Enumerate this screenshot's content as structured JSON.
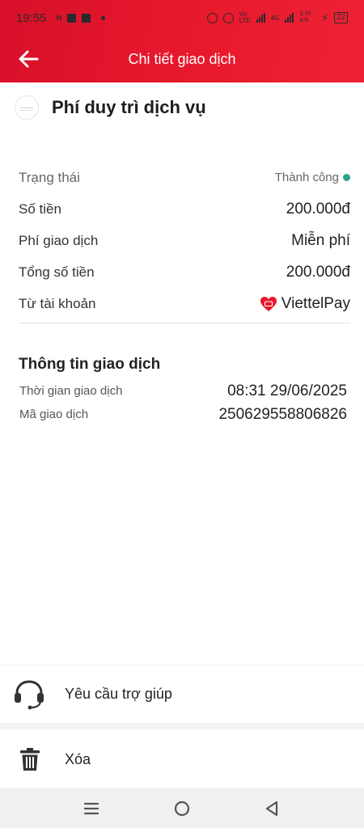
{
  "status_bar": {
    "time": "19:55",
    "left_small": "H",
    "volte": "Vo LTE",
    "network": "4G",
    "speed": "3.70 K/S",
    "battery": "22"
  },
  "header": {
    "title": "Chi tiết giao dịch"
  },
  "service": {
    "name": "Phí duy trì dịch vụ"
  },
  "details": [
    {
      "label": "Trạng thái",
      "value": "Thành công"
    },
    {
      "label": "Số tiền",
      "value": "200.000đ"
    },
    {
      "label": "Phí giao dịch",
      "value": "Miễn phí"
    },
    {
      "label": "Tổng số tiền",
      "value": "200.000đ"
    },
    {
      "label": "Từ tài khoản",
      "value": "ViettelPay"
    }
  ],
  "info": {
    "title": "Thông tin giao dịch",
    "rows": [
      {
        "label": "Thời gian giao dịch",
        "value": "08:31 29/06/2025"
      },
      {
        "label": "Mã giao dịch",
        "value": "250629558806826"
      }
    ]
  },
  "actions": {
    "help": {
      "label": "Yêu cầu trợ giúp",
      "icon": "headset-icon"
    },
    "delete": {
      "label": "Xóa",
      "icon": "trash-icon"
    }
  },
  "colors": {
    "brand_red": "#e8192c",
    "status_green": "#2ba58f"
  }
}
